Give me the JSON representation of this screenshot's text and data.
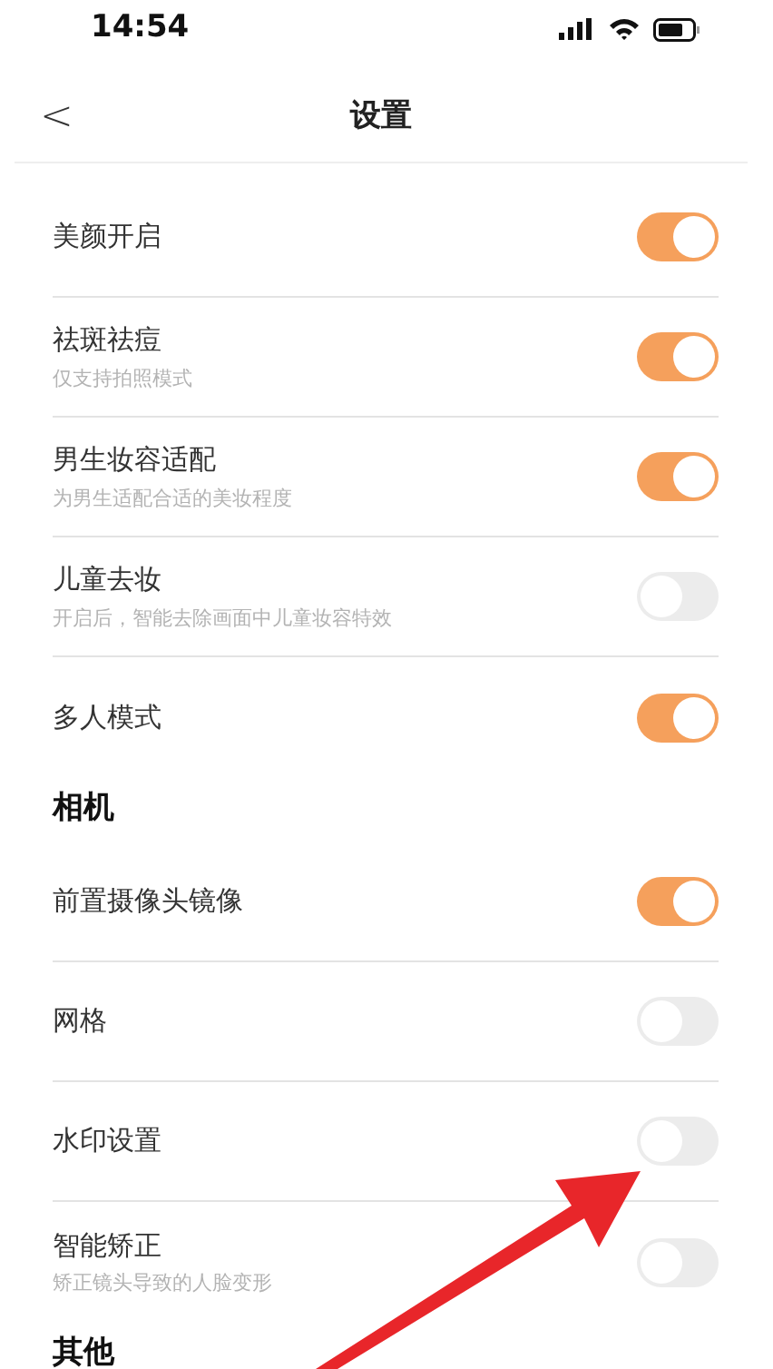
{
  "status_bar": {
    "time": "14:54"
  },
  "header": {
    "back": "<",
    "title": "设置"
  },
  "sections": [
    {
      "items": [
        {
          "label": "美颜开启",
          "on": true
        },
        {
          "label": "祛斑祛痘",
          "hint": "仅支持拍照模式",
          "on": true
        },
        {
          "label": "男生妆容适配",
          "hint": "为男生适配合适的美妆程度",
          "on": true
        },
        {
          "label": "儿童去妆",
          "hint": "开启后，智能去除画面中儿童妆容特效",
          "on": false
        },
        {
          "label": "多人模式",
          "on": true
        }
      ]
    },
    {
      "title": "相机",
      "items": [
        {
          "label": "前置摄像头镜像",
          "on": true
        },
        {
          "label": "网格",
          "on": false
        },
        {
          "label": "水印设置",
          "on": false
        },
        {
          "label": "智能矫正",
          "hint": "矫正镜头导致的人脸变形",
          "on": false
        }
      ]
    },
    {
      "title": "其他"
    }
  ],
  "annotations": [
    {
      "kind": "arrow"
    }
  ]
}
